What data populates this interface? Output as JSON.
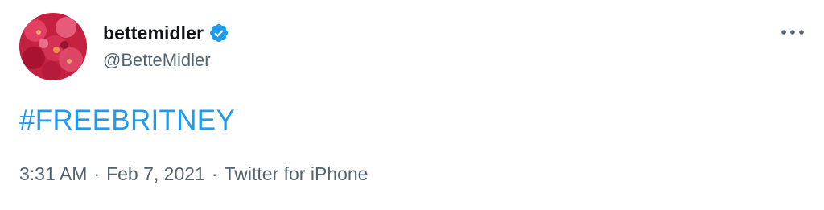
{
  "tweet": {
    "display_name": "bettemidler",
    "handle": "@BetteMidler",
    "hashtag": "#FREEBRITNEY",
    "time": "3:31 AM",
    "date": "Feb 7, 2021",
    "source": "Twitter for iPhone",
    "separator": "·",
    "icons": {
      "verified": "verified-badge-icon",
      "more": "more-options-icon",
      "avatar": "avatar-image"
    },
    "colors": {
      "accent": "#1d9bf0",
      "text_primary": "#0f1419",
      "text_secondary": "#536471"
    }
  }
}
